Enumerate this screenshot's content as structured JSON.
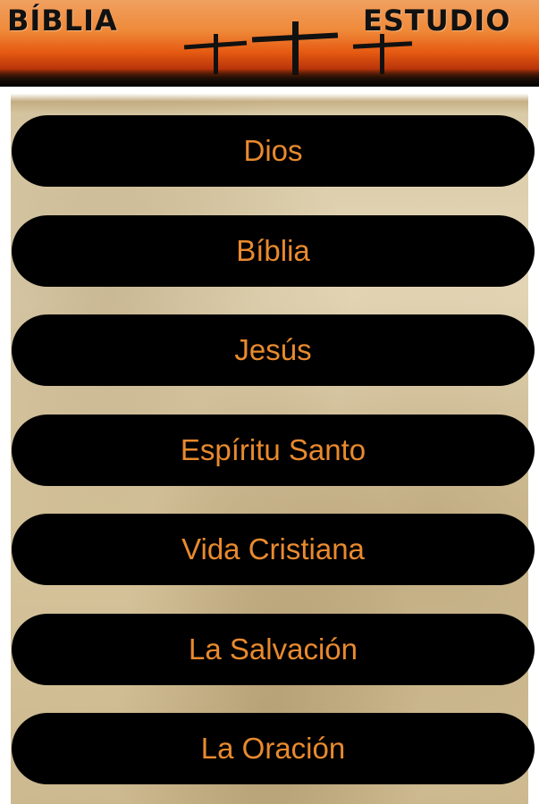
{
  "header": {
    "title_left": "BÍBLIA",
    "title_right": "ESTUDIO"
  },
  "menu": {
    "items": [
      {
        "label": "Dios"
      },
      {
        "label": "Bíblia"
      },
      {
        "label": "Jesús"
      },
      {
        "label": "Espíritu Santo"
      },
      {
        "label": "Vida Cristiana"
      },
      {
        "label": "La Salvación"
      },
      {
        "label": "La Oración"
      }
    ]
  },
  "colors": {
    "button_bg": "#000000",
    "button_text": "#e98a2e",
    "header_orange": "#ef8a3a"
  }
}
